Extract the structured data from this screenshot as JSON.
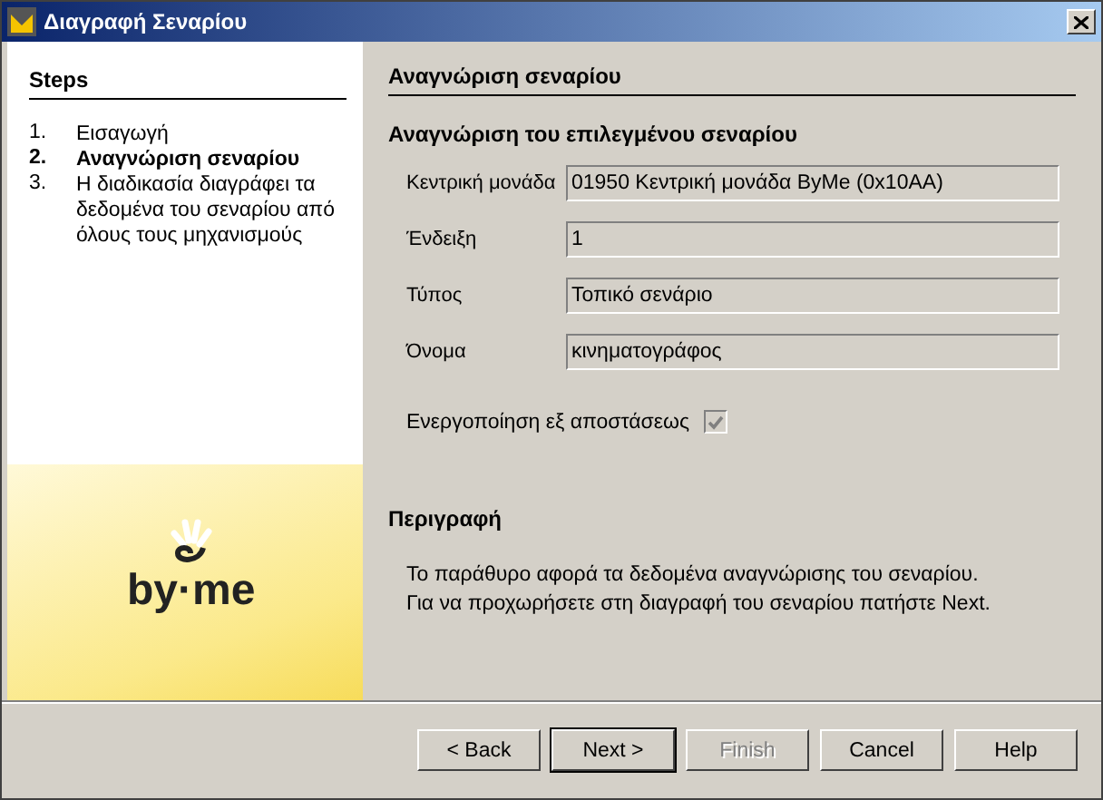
{
  "window": {
    "title": "Διαγραφή Σεναρίου"
  },
  "steps": {
    "title": "Steps",
    "items": [
      {
        "number": "1.",
        "label": "Εισαγωγή",
        "selected": false
      },
      {
        "number": "2.",
        "label": "Αναγνώριση σεναρίου",
        "selected": true
      },
      {
        "number": "3.",
        "label": "Η διαδικασία διαγράφει τα δεδομένα του σεναρίου από όλους τους μηχανισμούς",
        "selected": false
      }
    ]
  },
  "logo": {
    "text": "by·me"
  },
  "page": {
    "title": "Αναγνώριση σεναρίου",
    "subtitle": "Αναγνώριση του επιλεγμένου σεναρίου",
    "fields": [
      {
        "label": "Κεντρική μονάδα",
        "value": "01950 Κεντρική μονάδα ByMe (0x10AA)"
      },
      {
        "label": "Ένδειξη",
        "value": "1"
      },
      {
        "label": "Τύπος",
        "value": "Τοπικό σενάριο"
      },
      {
        "label": "Όνομα",
        "value": "κινηματογράφος"
      }
    ],
    "remote": {
      "label": "Ενεργοποίηση εξ αποστάσεως",
      "checked": true,
      "disabled": true
    },
    "description": {
      "title": "Περιγραφή",
      "lines": [
        "Το παράθυρο αφορά τα δεδομένα αναγνώρισης του σεναρίου.",
        "Για να προχωρήσετε στη διαγραφή του σεναρίου πατήστε Next."
      ]
    }
  },
  "buttons": [
    {
      "label": "< Back",
      "disabled": false,
      "default": false
    },
    {
      "label": "Next >",
      "disabled": false,
      "default": true
    },
    {
      "label": "Finish",
      "disabled": true,
      "default": false
    },
    {
      "label": "Cancel",
      "disabled": false,
      "default": false
    },
    {
      "label": "Help",
      "disabled": false,
      "default": false
    }
  ]
}
